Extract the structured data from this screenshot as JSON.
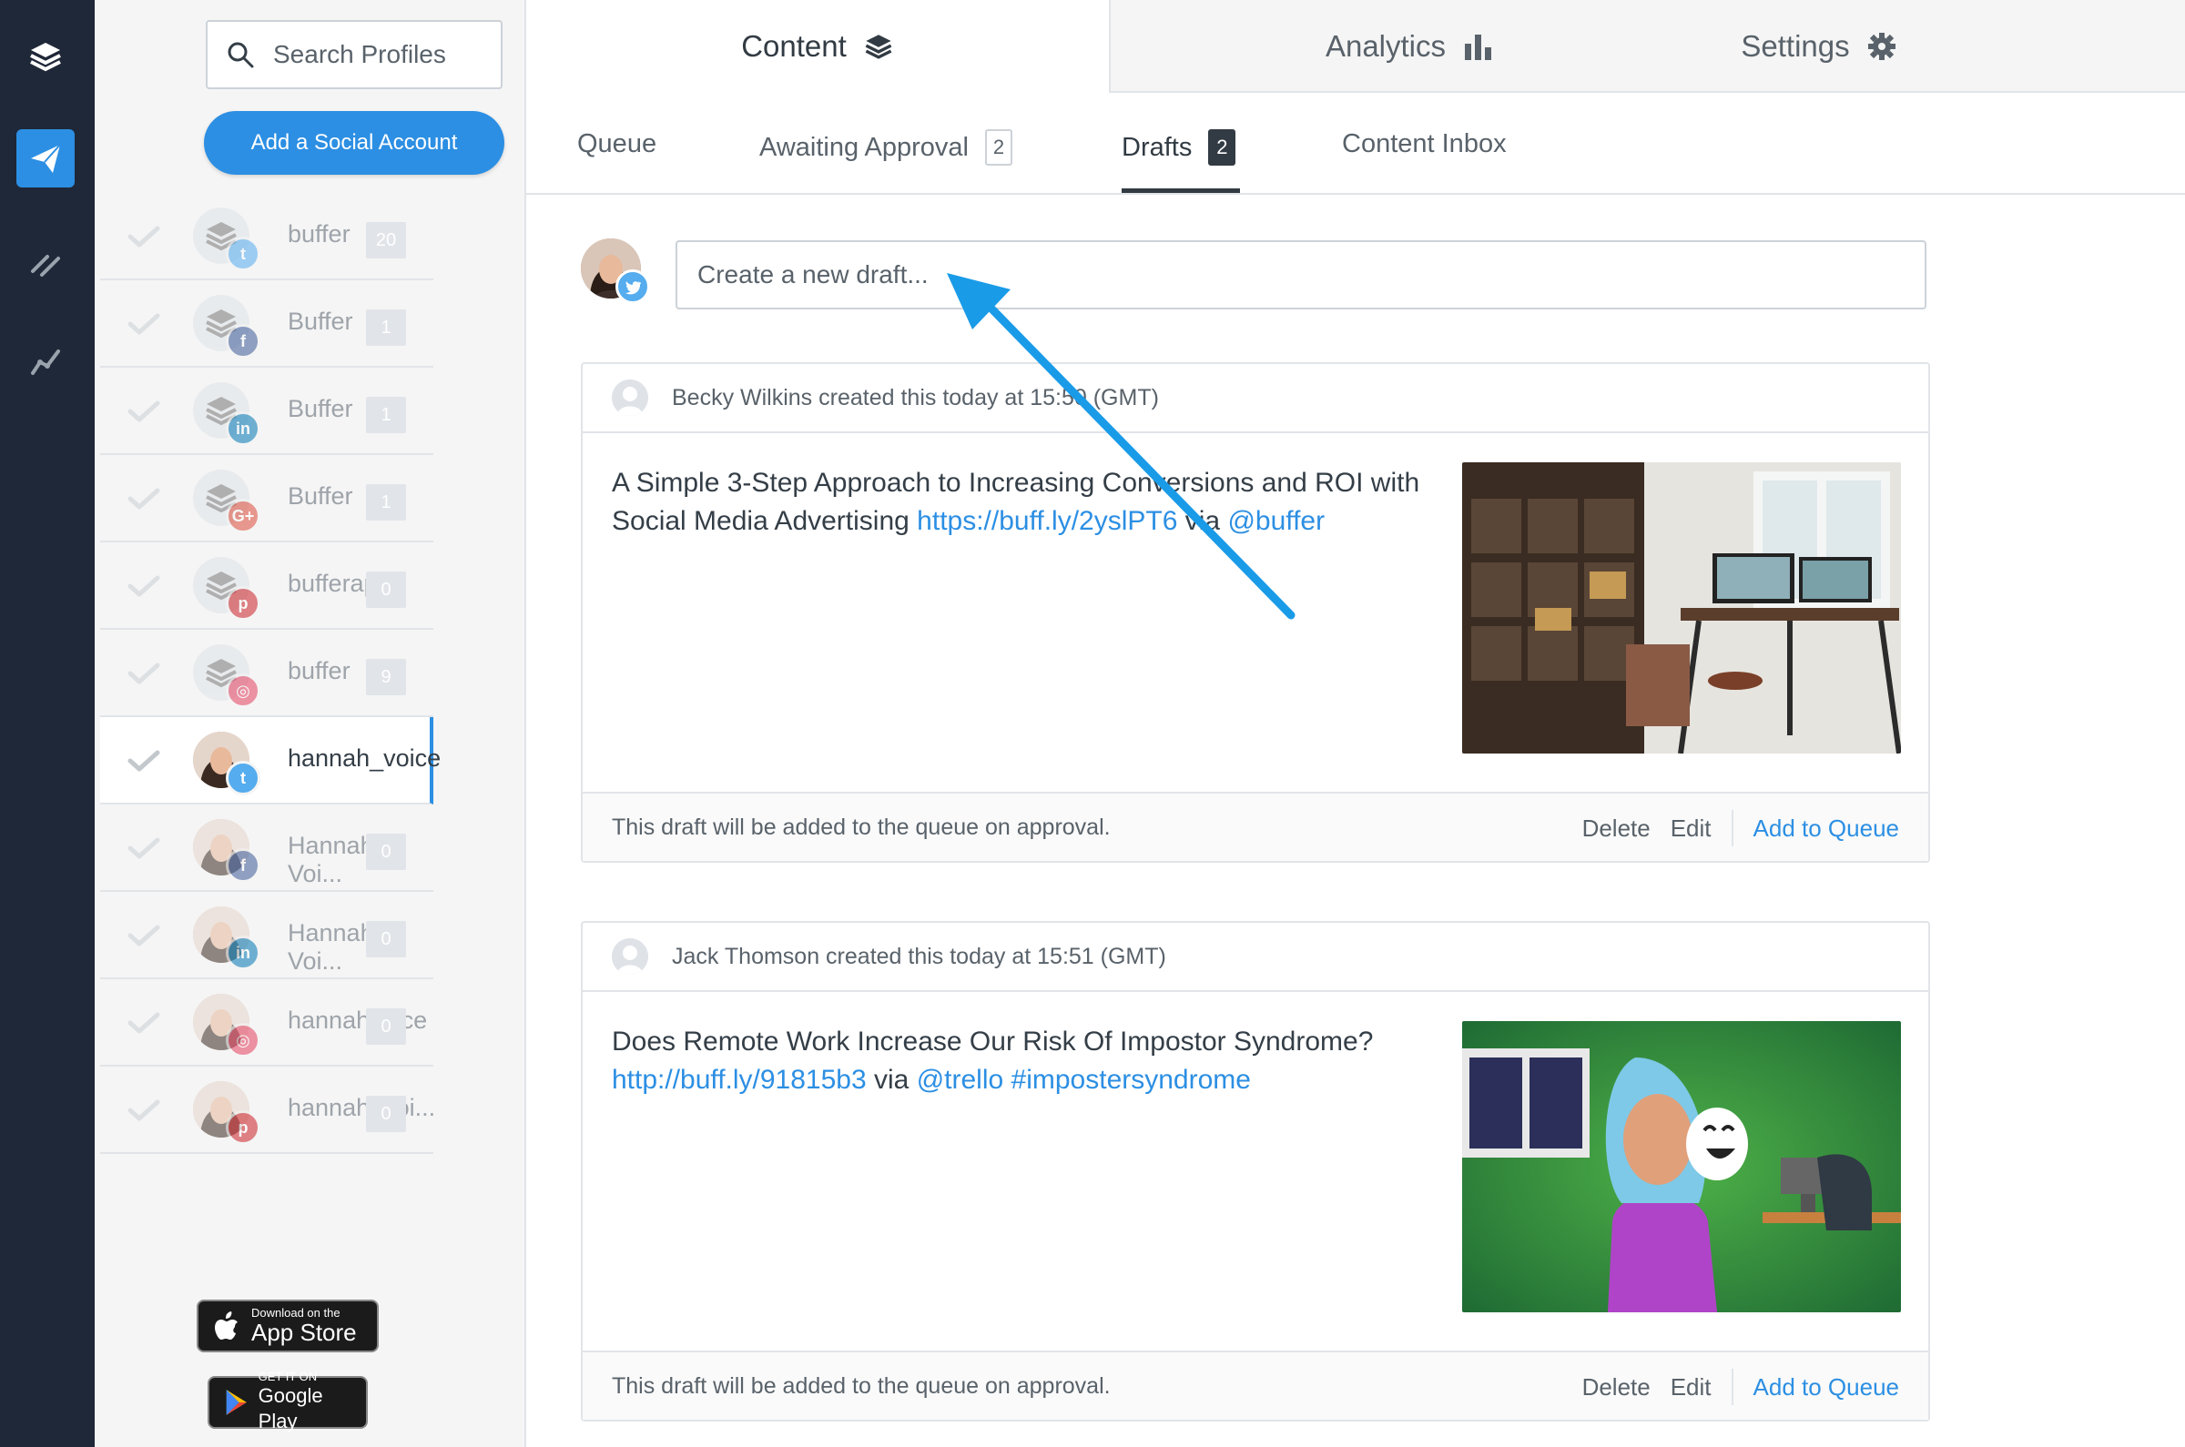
{
  "search": {
    "placeholder": "Search Profiles"
  },
  "sidebar": {
    "add_button": "Add a Social Account",
    "profiles": [
      {
        "name": "buffer",
        "network": "twitter",
        "count": "20"
      },
      {
        "name": "Buffer",
        "network": "facebook",
        "count": "1"
      },
      {
        "name": "Buffer",
        "network": "linkedin",
        "count": "1"
      },
      {
        "name": "Buffer",
        "network": "google-plus",
        "count": "1"
      },
      {
        "name": "bufferapp",
        "network": "pinterest",
        "count": "0"
      },
      {
        "name": "buffer",
        "network": "instagram",
        "count": "9"
      },
      {
        "name": "hannah_voice",
        "network": "twitter",
        "count": ""
      },
      {
        "name": "Hannah Voi...",
        "network": "facebook",
        "count": "0"
      },
      {
        "name": "Hannah Voi...",
        "network": "linkedin",
        "count": "0"
      },
      {
        "name": "hannahvoice",
        "network": "instagram",
        "count": "0"
      },
      {
        "name": "hannah_voi...",
        "network": "pinterest",
        "count": "0"
      }
    ],
    "app_store": {
      "small": "Download on the",
      "big": "App Store"
    },
    "google_play": {
      "small": "GET IT ON",
      "big": "Google Play"
    }
  },
  "tabs": {
    "content": "Content",
    "analytics": "Analytics",
    "settings": "Settings"
  },
  "subtabs": {
    "queue": "Queue",
    "awaiting": "Awaiting Approval",
    "awaiting_count": "2",
    "drafts": "Drafts",
    "drafts_count": "2",
    "inbox": "Content Inbox"
  },
  "composer": {
    "placeholder": "Create a new draft..."
  },
  "posts": [
    {
      "author_line": "Becky Wilkins created this today at 15:50 (GMT)",
      "text_plain": "A Simple 3-Step Approach to Increasing Conversions and ROI with Social Media Advertising ",
      "link": "https://buff.ly/2yslPT6",
      "via": " via ",
      "mention": "@buffer",
      "hashtag": "",
      "footer": "This draft will be added to the queue on approval.",
      "delete": "Delete",
      "edit": "Edit",
      "add_queue": "Add to Queue"
    },
    {
      "author_line": "Jack Thomson created this today at 15:51 (GMT)",
      "text_plain": "Does Remote Work Increase Our Risk Of Impostor Syndrome? ",
      "link": "http://buff.ly/91815b3",
      "via": " via ",
      "mention": "@trello",
      "hashtag": " #impostersyndrome",
      "footer": "This draft will be added to the queue on approval.",
      "delete": "Delete",
      "edit": "Edit",
      "add_queue": "Add to Queue"
    }
  ],
  "colors": {
    "accent": "#2c8fe3",
    "rail": "#1f2838",
    "twitter": "#55acee",
    "facebook": "#3b5998",
    "linkedin": "#0077b5",
    "google_plus": "#dd4b39",
    "pinterest": "#cb2027",
    "instagram": "#e4405f"
  }
}
